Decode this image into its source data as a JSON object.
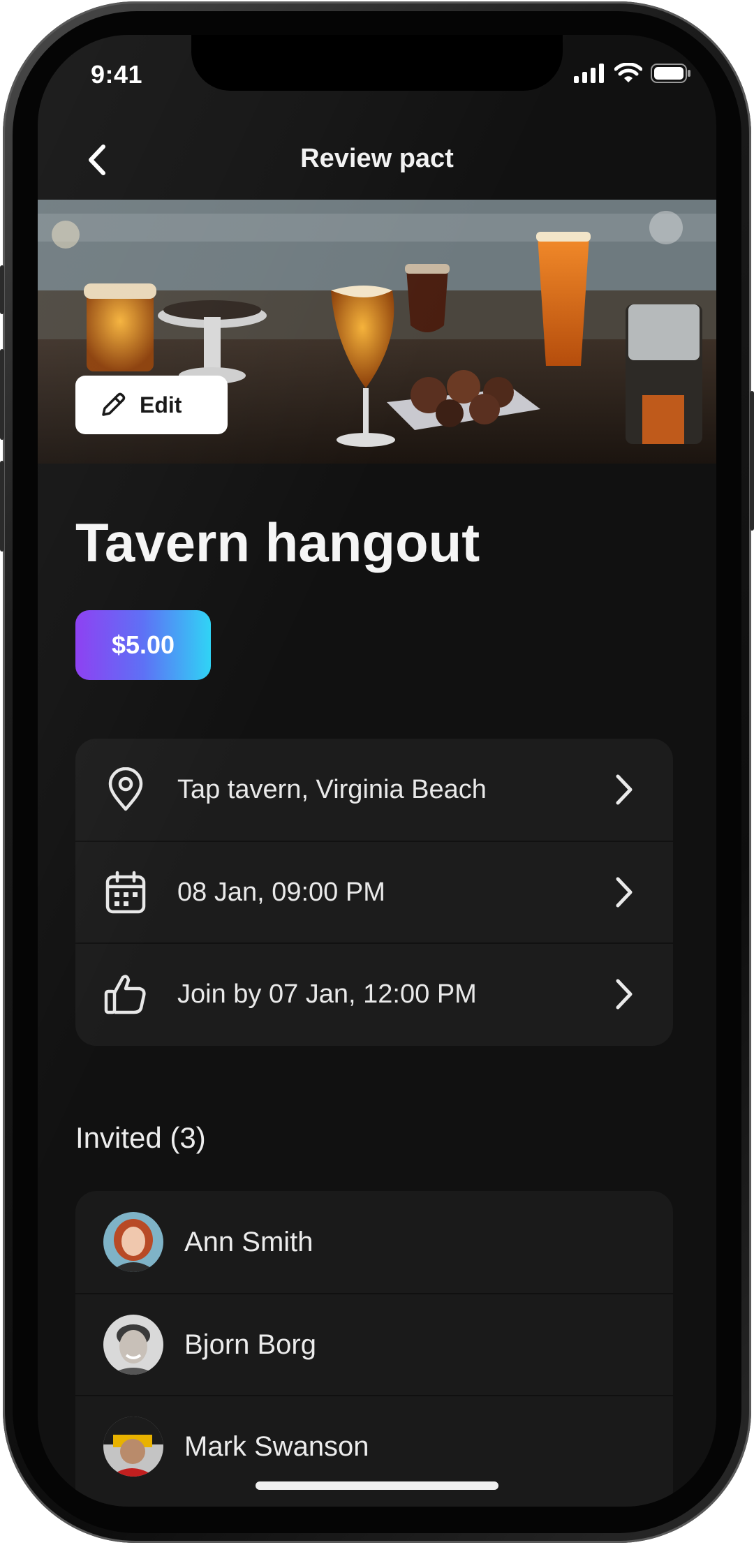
{
  "status_bar": {
    "time": "9:41"
  },
  "nav": {
    "title": "Review pact",
    "back_icon": "chevron-left-icon"
  },
  "hero": {
    "edit_label": "Edit",
    "edit_icon": "pencil-icon"
  },
  "pact": {
    "title": "Tavern hangout",
    "price": "$5.00",
    "details": [
      {
        "icon": "location-pin-icon",
        "text": "Tap tavern, Virginia Beach"
      },
      {
        "icon": "calendar-icon",
        "text": "08 Jan, 09:00 PM"
      },
      {
        "icon": "thumbs-up-icon",
        "text": "Join by 07 Jan, 12:00 PM"
      }
    ]
  },
  "invited": {
    "title": "Invited (3)",
    "people": [
      {
        "name": "Ann Smith"
      },
      {
        "name": "Bjorn Borg"
      },
      {
        "name": "Mark Swanson"
      }
    ]
  },
  "colors": {
    "background": "#111111",
    "card": "#1c1c1c",
    "price_gradient_start": "#8b3cf2",
    "price_gradient_end": "#2ed3f5"
  }
}
